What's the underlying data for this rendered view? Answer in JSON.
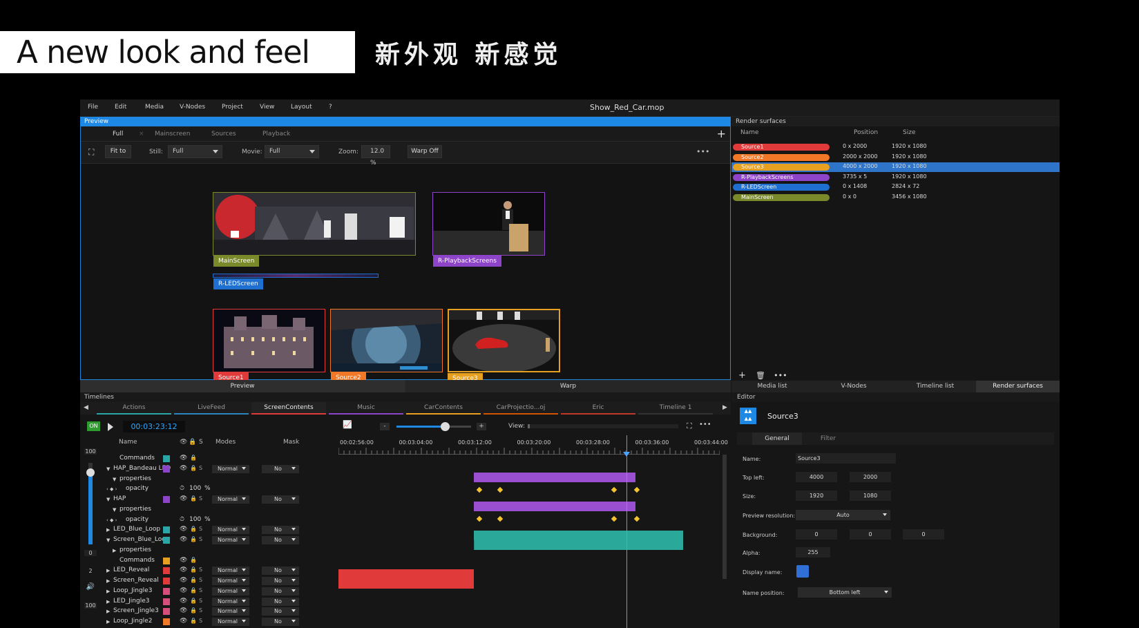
{
  "banner": {
    "title": "A new look and feel",
    "subtitle": "新外观  新感觉"
  },
  "menu": [
    "File",
    "Edit",
    "Media",
    "V-Nodes",
    "Project",
    "View",
    "Layout",
    "?"
  ],
  "window_title": "Show_Red_Car.mop",
  "preview": {
    "header": "Preview",
    "tabs": [
      "Full",
      "Mainscreen",
      "Sources",
      "Playback"
    ],
    "toolbar": {
      "fit_to": "Fit to",
      "still_label": "Still:",
      "still_value": "Full",
      "movie_label": "Movie:",
      "movie_value": "Full",
      "zoom_label": "Zoom:",
      "zoom_value": "12.0",
      "zoom_unit": "%",
      "warp_off": "Warp Off",
      "more": "•••"
    },
    "surfaces": [
      {
        "label": "MainScreen",
        "color": "#7a8a2a"
      },
      {
        "label": "R-PlaybackScreens",
        "color": "#8e44c8"
      },
      {
        "label": "R-LEDScreen",
        "color": "#1f6fd0"
      },
      {
        "label": "Source1",
        "color": "#e03a3a"
      },
      {
        "label": "Source2",
        "color": "#f07826"
      },
      {
        "label": "Source3",
        "color": "#e8a020"
      }
    ],
    "bottom_tabs": [
      "Preview",
      "Warp"
    ]
  },
  "render_surfaces": {
    "header": "Render surfaces",
    "columns": [
      "Name",
      "Position",
      "Size"
    ],
    "rows": [
      {
        "name": "Source1",
        "position": "0 x 2000",
        "size": "1920 x 1080",
        "color": "#e03a3a"
      },
      {
        "name": "Source2",
        "position": "2000 x 2000",
        "size": "1920 x 1080",
        "color": "#f07826"
      },
      {
        "name": "Source3",
        "position": "4000 x 2000",
        "size": "1920 x 1080",
        "color": "#e8a020"
      },
      {
        "name": "R-PlaybackScreens",
        "position": "3735 x 5",
        "size": "1920 x 1080",
        "color": "#8e44c8"
      },
      {
        "name": "R-LEDScreen",
        "position": "0 x 1408",
        "size": "2824 x 72",
        "color": "#1f6fd0"
      },
      {
        "name": "MainScreen",
        "position": "0 x 0",
        "size": "3456 x 1080",
        "color": "#7a8a2a"
      }
    ],
    "tools": {
      "add": "+",
      "delete": "🗑",
      "more": "•••"
    },
    "tabs": [
      "Media list",
      "V-Nodes",
      "Timeline list",
      "Render surfaces"
    ]
  },
  "timelines": {
    "header": "Timelines",
    "tabs": [
      {
        "label": "Actions",
        "color": "#2aa6a6"
      },
      {
        "label": "LiveFeed",
        "color": "#2e86c1"
      },
      {
        "label": "ScreenContents",
        "color": "#e03a3a"
      },
      {
        "label": "Music",
        "color": "#8e44c8"
      },
      {
        "label": "CarContents",
        "color": "#e8a020"
      },
      {
        "label": "CarProjectio...oj imported)",
        "color": "#d35400"
      },
      {
        "label": "Eric",
        "color": "#c0392b"
      },
      {
        "label": "Timeline 1",
        "color": "#333333"
      }
    ],
    "on_label": "ON",
    "timecode": "00:03:23:12",
    "columns": {
      "name": "Name",
      "s": "S",
      "modes": "Modes",
      "mask": "Mask"
    },
    "view_label": "View:",
    "zoom_minus": "-",
    "zoom_plus": "+",
    "more": "•••",
    "side": {
      "top": "100",
      "mid": "0",
      "count": "2",
      "vol": "100",
      "speaker": "🔊"
    },
    "ruler": [
      "00:02:56:00",
      "00:03:04:00",
      "00:03:12:00",
      "00:03:20:00",
      "00:03:28:00",
      "00:03:36:00",
      "00:03:44:00"
    ],
    "rows": [
      {
        "name": "Commands",
        "indent": 1,
        "arrow": "",
        "color": "#2aa6a6",
        "type": "cmd"
      },
      {
        "name": "HAP_Bandeau LED",
        "indent": 0,
        "arrow": "▼",
        "color": "#8e44c8",
        "type": "layer",
        "mode": "Normal",
        "mask": "No"
      },
      {
        "name": "properties",
        "indent": 1,
        "arrow": "▼",
        "type": "prop"
      },
      {
        "name": "opacity",
        "indent": 2,
        "arrow": "",
        "type": "param",
        "value": "100",
        "unit": "%"
      },
      {
        "name": "HAP",
        "indent": 0,
        "arrow": "▼",
        "color": "#8e44c8",
        "type": "layer",
        "mode": "Normal",
        "mask": "No"
      },
      {
        "name": "properties",
        "indent": 1,
        "arrow": "▼",
        "type": "prop"
      },
      {
        "name": "opacity",
        "indent": 2,
        "arrow": "",
        "type": "param",
        "value": "100",
        "unit": "%"
      },
      {
        "name": "LED_Blue_Loop",
        "indent": 0,
        "arrow": "▶",
        "color": "#2aa6a6",
        "type": "layer",
        "mode": "Normal",
        "mask": "No"
      },
      {
        "name": "Screen_Blue_Loop",
        "indent": 0,
        "arrow": "▼",
        "color": "#2aa6a6",
        "type": "layer",
        "mode": "Normal",
        "mask": "No"
      },
      {
        "name": "properties",
        "indent": 1,
        "arrow": "▶",
        "type": "prop"
      },
      {
        "name": "Commands",
        "indent": 1,
        "arrow": "",
        "color": "#e8a020",
        "type": "cmd"
      },
      {
        "name": "LED_Reveal",
        "indent": 0,
        "arrow": "▶",
        "color": "#e03a3a",
        "type": "layer",
        "mode": "Normal",
        "mask": "No"
      },
      {
        "name": "Screen_Reveal",
        "indent": 0,
        "arrow": "▶",
        "color": "#e03a3a",
        "type": "layer",
        "mode": "Normal",
        "mask": "No"
      },
      {
        "name": "Loop_Jingle3",
        "indent": 0,
        "arrow": "▶",
        "color": "#d64f7a",
        "type": "layer",
        "mode": "Normal",
        "mask": "No"
      },
      {
        "name": "LED_Jingle3",
        "indent": 0,
        "arrow": "▶",
        "color": "#d64f7a",
        "type": "layer",
        "mode": "Normal",
        "mask": "No"
      },
      {
        "name": "Screen_Jingle3",
        "indent": 0,
        "arrow": "▶",
        "color": "#d64f7a",
        "type": "layer",
        "mode": "Normal",
        "mask": "No"
      },
      {
        "name": "Loop_Jingle2",
        "indent": 0,
        "arrow": "▶",
        "color": "#f07826",
        "type": "layer",
        "mode": "Normal",
        "mask": "No"
      }
    ]
  },
  "editor": {
    "header": "Editor",
    "title": "Source3",
    "tabs": [
      "General",
      "Filter"
    ],
    "name_label": "Name:",
    "name_value": "Source3",
    "topleft_label": "Top left:",
    "topleft_x": "4000",
    "topleft_y": "2000",
    "size_label": "Size:",
    "size_w": "1920",
    "size_h": "1080",
    "preview_res_label": "Preview resolution:",
    "preview_res_value": "Auto",
    "background_label": "Background:",
    "bg_r": "0",
    "bg_g": "0",
    "bg_b": "0",
    "alpha_label": "Alpha:",
    "alpha_value": "255",
    "display_name_label": "Display name:",
    "display_color": "#2f6fd6",
    "name_position_label": "Name position:",
    "name_position_value": "Bottom left"
  }
}
